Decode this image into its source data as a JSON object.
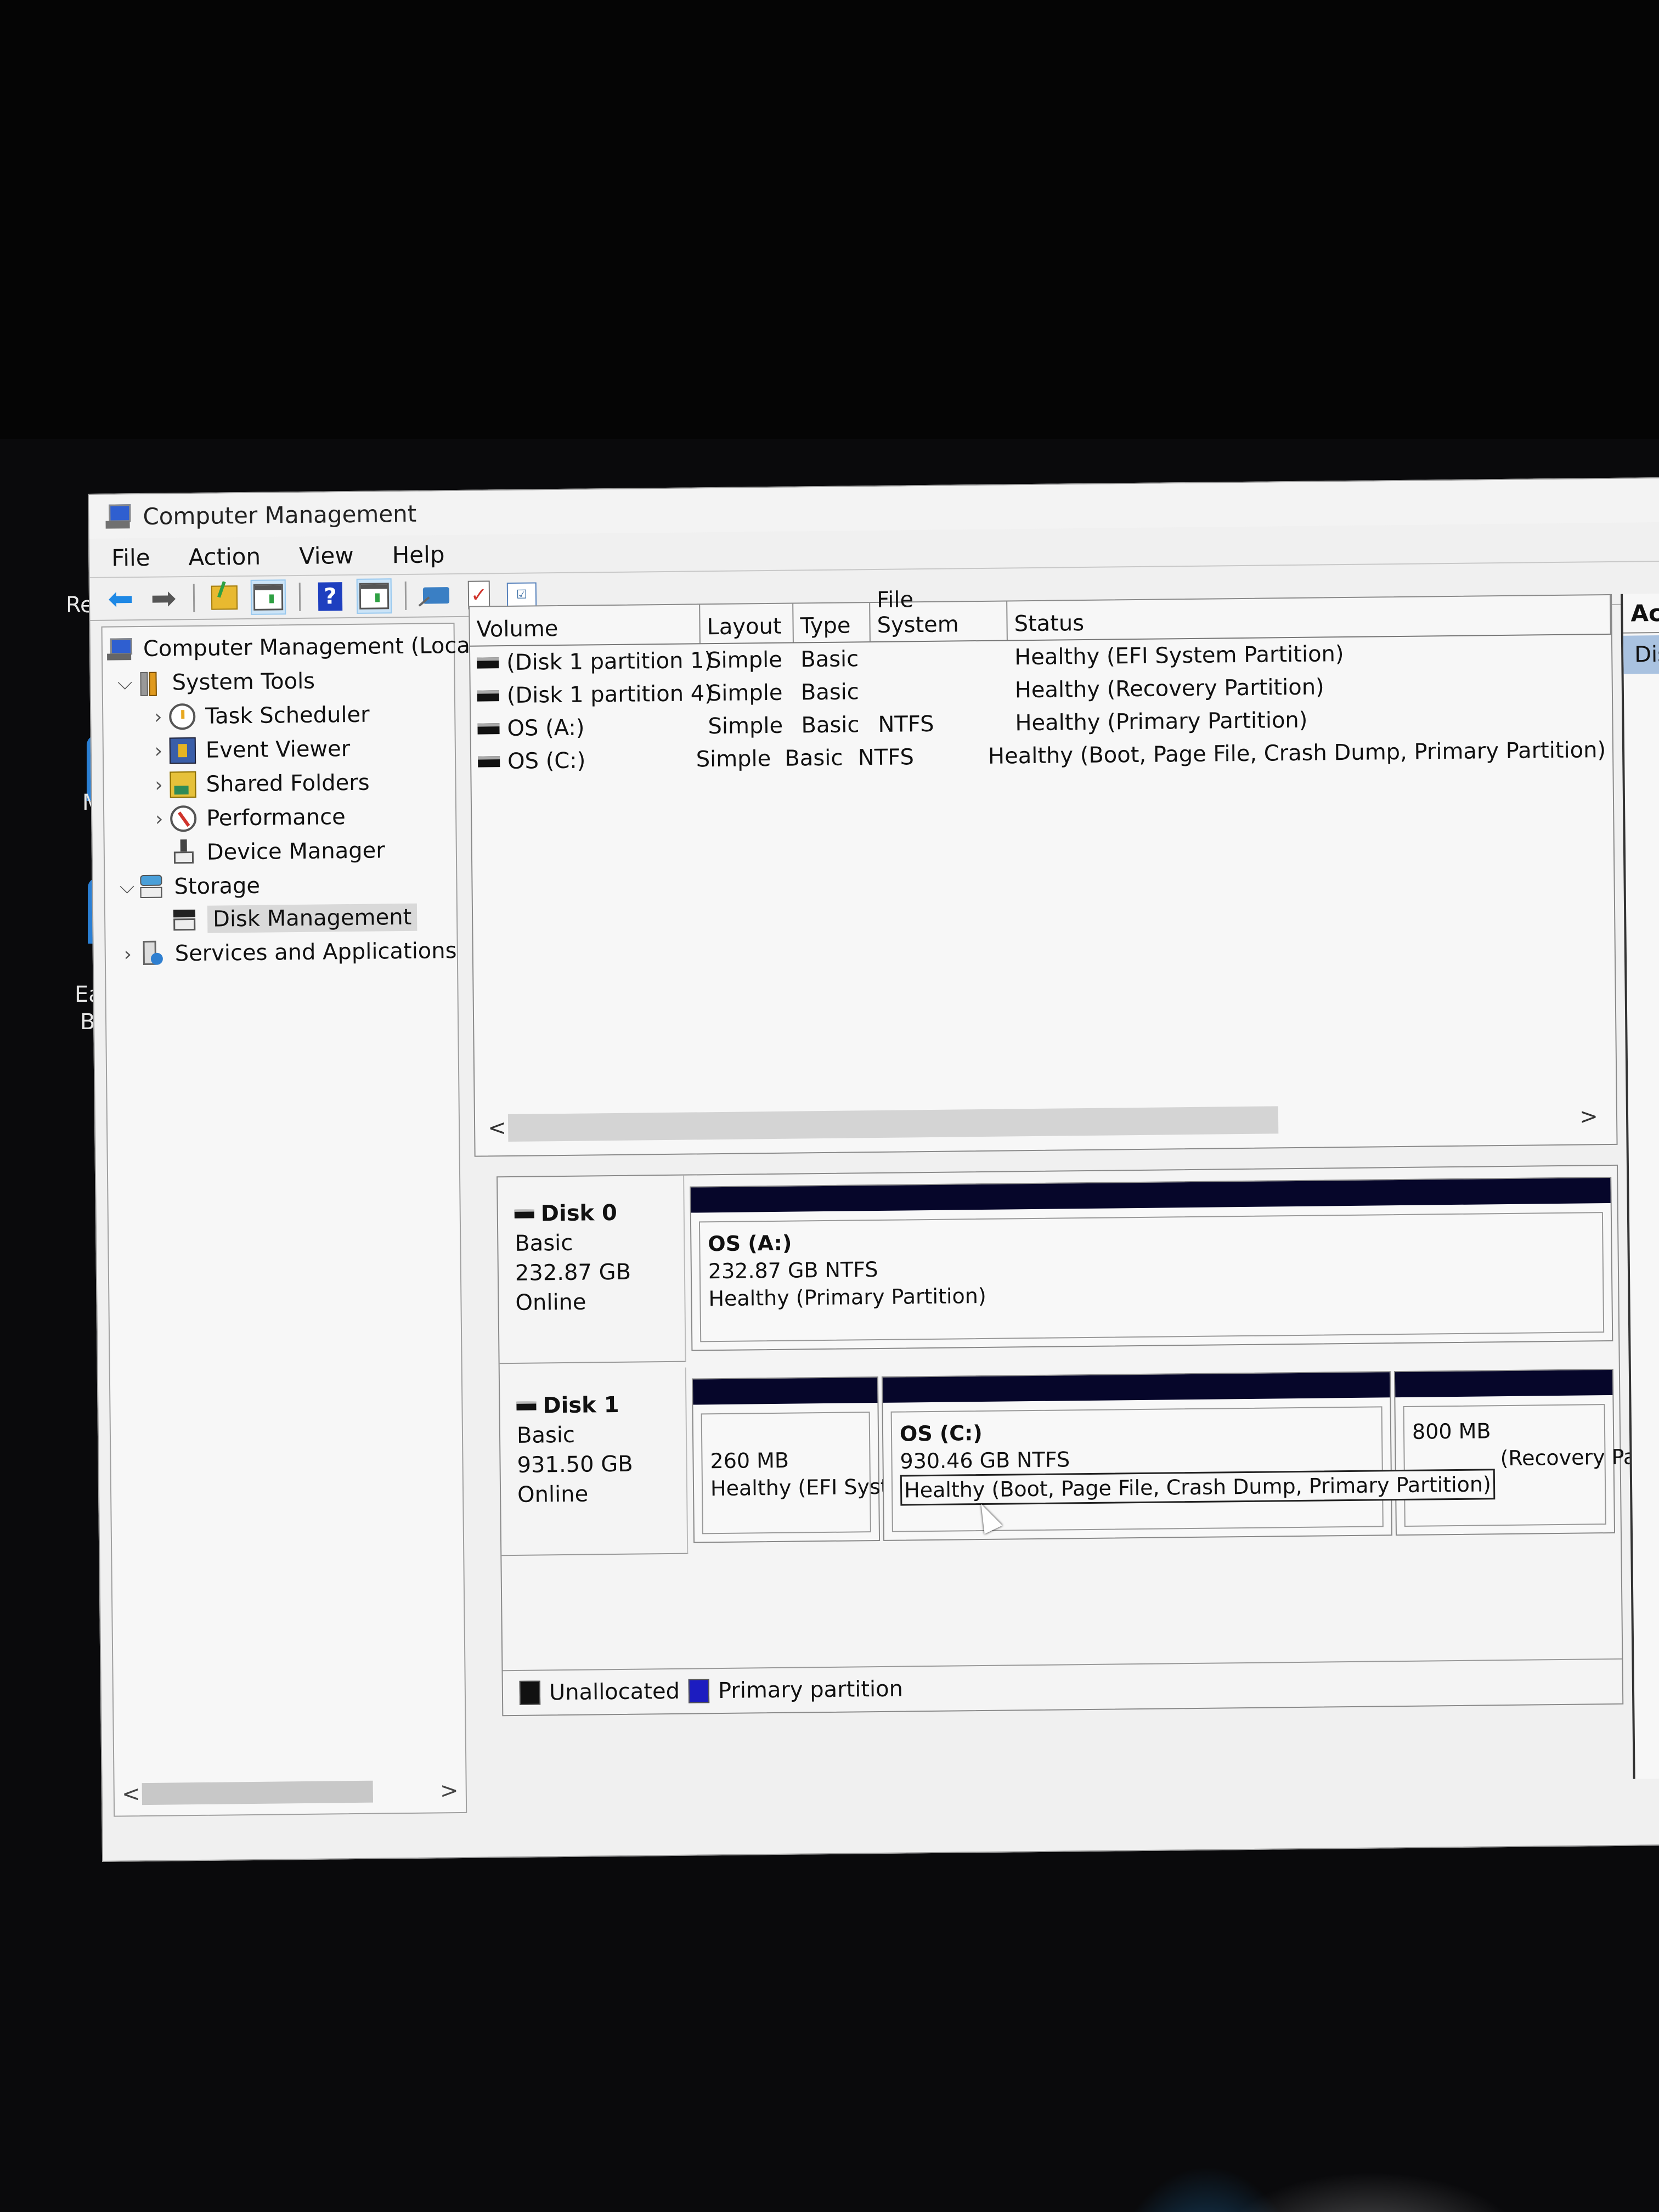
{
  "desktop": {
    "icon_labels": [
      "Re",
      "M",
      "Eas",
      "Ba"
    ]
  },
  "window": {
    "title": "Computer Management",
    "icon": "computer-management-icon"
  },
  "menu": [
    "File",
    "Action",
    "View",
    "Help"
  ],
  "toolbar": {
    "buttons": [
      {
        "name": "back",
        "icon": "arrow-left-icon"
      },
      {
        "name": "forward",
        "icon": "arrow-right-icon"
      },
      {
        "name": "up-one-level",
        "icon": "folder-up-icon"
      },
      {
        "name": "show-hide-console-tree",
        "icon": "console-tree-icon",
        "active": true
      },
      {
        "name": "help",
        "icon": "help-icon"
      },
      {
        "name": "show-hide-action-pane",
        "icon": "action-pane-icon",
        "active": true
      },
      {
        "name": "connect",
        "icon": "connect-icon"
      },
      {
        "name": "check",
        "icon": "checkmark-icon"
      },
      {
        "name": "properties",
        "icon": "list-icon"
      }
    ]
  },
  "tree": {
    "items": [
      {
        "label": "Computer Management (Local",
        "level": 0,
        "icon": "computer-icon",
        "expander": ""
      },
      {
        "label": "System Tools",
        "level": 1,
        "icon": "tools-icon",
        "expander": "expanded"
      },
      {
        "label": "Task Scheduler",
        "level": 2,
        "icon": "clock-icon",
        "expander": "collapsed"
      },
      {
        "label": "Event Viewer",
        "level": 2,
        "icon": "event-viewer-icon",
        "expander": "collapsed"
      },
      {
        "label": "Shared Folders",
        "level": 2,
        "icon": "shared-folders-icon",
        "expander": "collapsed"
      },
      {
        "label": "Performance",
        "level": 2,
        "icon": "performance-icon",
        "expander": "collapsed"
      },
      {
        "label": "Device Manager",
        "level": 2,
        "icon": "device-manager-icon",
        "expander": ""
      },
      {
        "label": "Storage",
        "level": 1,
        "icon": "storage-icon",
        "expander": "expanded"
      },
      {
        "label": "Disk Management",
        "level": 2,
        "icon": "disk-management-icon",
        "expander": "",
        "selected": true
      },
      {
        "label": "Services and Applications",
        "level": 1,
        "icon": "services-icon",
        "expander": "collapsed"
      }
    ],
    "scroll_left": "<",
    "scroll_right": ">"
  },
  "volumes": {
    "columns": [
      "Volume",
      "Layout",
      "Type",
      "File System",
      "Status"
    ],
    "rows": [
      {
        "volume": "(Disk 1 partition 1)",
        "layout": "Simple",
        "type": "Basic",
        "fs": "",
        "status": "Healthy (EFI System Partition)"
      },
      {
        "volume": "(Disk 1 partition 4)",
        "layout": "Simple",
        "type": "Basic",
        "fs": "",
        "status": "Healthy (Recovery Partition)"
      },
      {
        "volume": "OS (A:)",
        "layout": "Simple",
        "type": "Basic",
        "fs": "NTFS",
        "status": "Healthy (Primary Partition)"
      },
      {
        "volume": "OS (C:)",
        "layout": "Simple",
        "type": "Basic",
        "fs": "NTFS",
        "status": "Healthy (Boot, Page File, Crash Dump, Primary Partition)"
      }
    ],
    "scroll_left": "<",
    "scroll_right": ">"
  },
  "disks": [
    {
      "name": "Disk 0",
      "type": "Basic",
      "size": "232.87 GB",
      "state": "Online",
      "partitions": [
        {
          "name": "OS  (A:)",
          "size": "232.87 GB NTFS",
          "status": "Healthy (Primary Partition)"
        }
      ]
    },
    {
      "name": "Disk 1",
      "type": "Basic",
      "size": "931.50 GB",
      "state": "Online",
      "partitions": [
        {
          "name": "",
          "size": "260 MB",
          "status": "Healthy (EFI Syst"
        },
        {
          "name": "OS  (C:)",
          "size": "930.46 GB NTFS",
          "status": "Healthy (Boot, Page File, Crash Dump, Primary Partition)",
          "focused": true
        },
        {
          "name": "",
          "size": "800 MB",
          "status": "(Recovery Pa"
        }
      ]
    }
  ],
  "legend": [
    {
      "label": "Unallocated",
      "color": "#111111"
    },
    {
      "label": "Primary partition",
      "color": "#1c1cc0"
    }
  ],
  "actions": {
    "header": "Actio",
    "items": [
      "Disk"
    ]
  }
}
